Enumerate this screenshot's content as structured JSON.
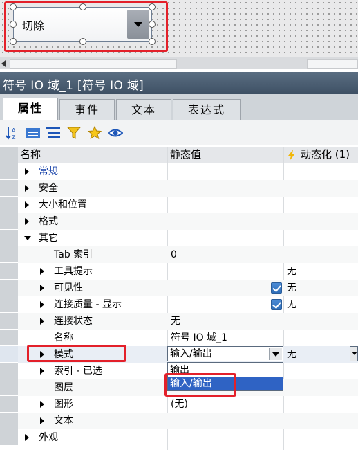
{
  "canvas": {
    "combo_text": "切除"
  },
  "panel": {
    "title": "符号 IO 域_1 [符号 IO 域]",
    "tabs": [
      "属性",
      "事件",
      "文本",
      "表达式"
    ],
    "toolbar_icons": [
      "sort-az-icon",
      "group-icon",
      "list-icon",
      "filter-icon",
      "favorite-star-icon",
      "eye-icon"
    ]
  },
  "grid": {
    "headers": {
      "name": "名称",
      "static": "静态值",
      "dynamic": "动态化 (1)"
    },
    "rows": [
      {
        "name": "常规",
        "static": "",
        "dynamic": ""
      },
      {
        "name": "安全",
        "static": "",
        "dynamic": ""
      },
      {
        "name": "大小和位置",
        "static": "",
        "dynamic": ""
      },
      {
        "name": "格式",
        "static": "",
        "dynamic": ""
      },
      {
        "name": "其它",
        "static": "",
        "dynamic": ""
      },
      {
        "name": "Tab 索引",
        "static": "0",
        "dynamic": ""
      },
      {
        "name": "工具提示",
        "static": "",
        "dynamic": "无"
      },
      {
        "name": "可见性",
        "static": "",
        "dynamic": "无",
        "checked": true
      },
      {
        "name": "连接质量 - 显示",
        "static": "",
        "dynamic": "无",
        "checked": true
      },
      {
        "name": "连接状态",
        "static": "无",
        "dynamic": ""
      },
      {
        "name": "名称",
        "static": "符号 IO 域_1",
        "dynamic": ""
      },
      {
        "name": "模式",
        "static": "输入/输出",
        "dynamic": "无"
      },
      {
        "name": "索引 - 已选",
        "static": "",
        "dynamic": ""
      },
      {
        "name": "图层",
        "static": "",
        "dynamic": ""
      },
      {
        "name": "图形",
        "static": "(无)",
        "dynamic": ""
      },
      {
        "name": "文本",
        "static": "",
        "dynamic": ""
      },
      {
        "name": "外观",
        "static": "",
        "dynamic": ""
      }
    ]
  },
  "mode_dropdown": {
    "selected": "输入/输出",
    "options": [
      "输出",
      "输入/输出"
    ]
  },
  "colors": {
    "highlight": "#e3202a",
    "selection": "#2f63c4",
    "title_bar": "#4b5e72"
  }
}
